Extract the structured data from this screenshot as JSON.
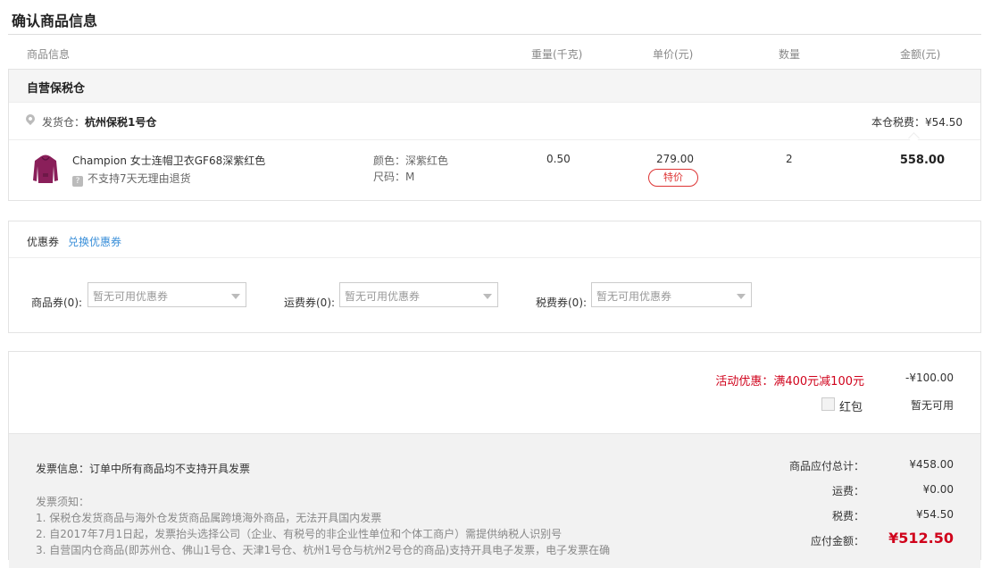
{
  "page_title": "确认商品信息",
  "columns": {
    "product": "商品信息",
    "weight": "重量(千克)",
    "unit_price": "单价(元)",
    "quantity": "数量",
    "amount": "金额(元)"
  },
  "warehouse": {
    "name": "自营保税仓",
    "ship_from_label": "发货仓：",
    "ship_from": "杭州保税1号仓",
    "tax_text": "本仓税费：¥54.50"
  },
  "product": {
    "name": "Champion 女士连帽卫衣GF68深紫红色",
    "return_note": "不支持7天无理由退货",
    "return_icon": "?",
    "color": "颜色：深紫红色",
    "size": "尺码：M",
    "weight": "0.50",
    "unit_price": "279.00",
    "badge": "特价",
    "quantity": "2",
    "amount": "558.00",
    "image_color": "#8a1f5a"
  },
  "coupons": {
    "label": "优惠券",
    "redeem_link": "兑换优惠券",
    "product_label": "商品券(0):",
    "shipping_label": "运费券(0):",
    "tax_label": "税费券(0):",
    "placeholder": "暂无可用优惠券"
  },
  "summary": {
    "promotion": "活动优惠：满400元减100元",
    "promotion_value": "-¥100.00",
    "red_packet_label": "红包",
    "red_packet_value": "暂无可用",
    "invoice_info": "发票信息：订单中所有商品均不支持开具发票",
    "notice_title": "发票须知：",
    "notice_1": "1. 保税仓发货商品与海外仓发货商品属跨境海外商品，无法开具国内发票",
    "notice_2": "2. 自2017年7月1日起，发票抬头选择公司（企业、有税号的非企业性单位和个体工商户）需提供纳税人识别号",
    "notice_3": "3. 自营国内仓商品(即苏州仓、佛山1号仓、天津1号仓、杭州1号仓与杭州2号仓的商品)支持开具电子发票，电子发票在确",
    "goods_total_label": "商品应付总计：",
    "goods_total": "¥458.00",
    "shipping_label": "运费：",
    "shipping": "¥0.00",
    "tax_label": "税费：",
    "tax": "¥54.50",
    "payable_label": "应付金额：",
    "payable": "¥512.50"
  }
}
